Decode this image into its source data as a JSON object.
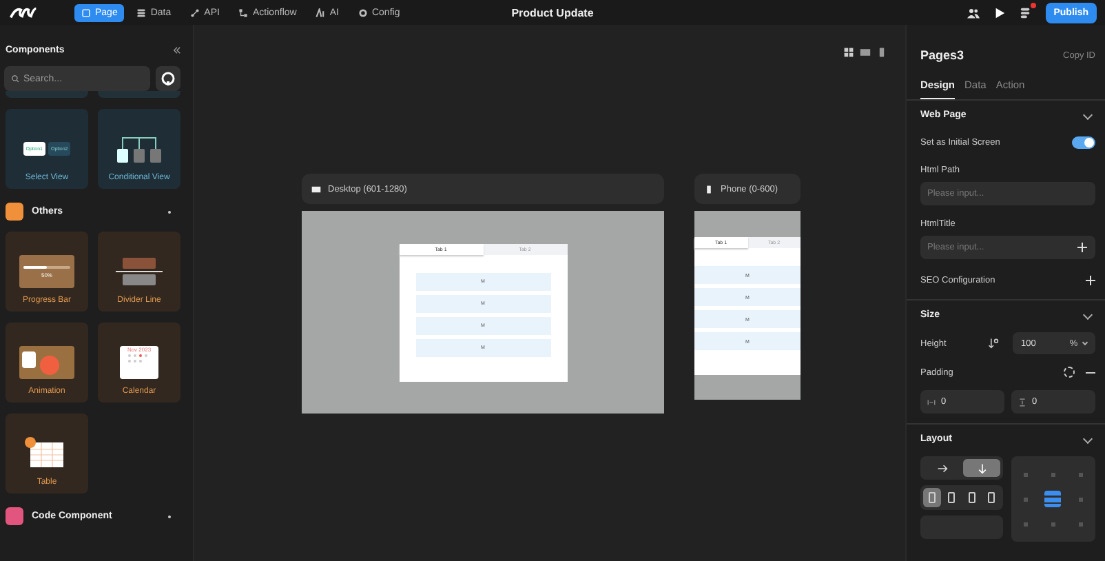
{
  "app_bar": {
    "nav": [
      {
        "label": "Page",
        "kind": "page",
        "selected": true
      },
      {
        "label": "Data",
        "kind": "data",
        "selected": false
      },
      {
        "label": "API",
        "kind": "api",
        "selected": false
      },
      {
        "label": "Actionflow",
        "kind": "flow",
        "selected": false
      },
      {
        "label": "AI",
        "kind": "ai",
        "selected": false
      },
      {
        "label": "Config",
        "kind": "config",
        "selected": false
      }
    ],
    "title": "Product Update",
    "notification": true,
    "publish": "Publish"
  },
  "components_panel": {
    "title": "Components",
    "search": {
      "placeholder": "Search..."
    },
    "top_cards": [
      {
        "kind": "select",
        "label": "Select View",
        "options": [
          "Option1",
          "Option2"
        ]
      },
      {
        "kind": "conditional",
        "label": "Conditional View"
      }
    ],
    "categories": [
      {
        "title": "Others",
        "kind": "others",
        "cards": [
          {
            "kind": "progress",
            "label": "Progress Bar",
            "level": 0.5,
            "reading": "50%"
          },
          {
            "kind": "divider",
            "label": "Divider Line"
          },
          {
            "kind": "animation",
            "label": "Animation"
          },
          {
            "kind": "calendar",
            "label": "Calendar",
            "month": "Nov 2023"
          },
          {
            "kind": "table",
            "label": "Table"
          }
        ]
      },
      {
        "title": "Code Component",
        "kind": "code"
      }
    ]
  },
  "canvas": {
    "views": [
      {
        "kind": "desktop",
        "label": "Desktop (601-1280)",
        "tabs": [
          {
            "label": "Tab 1",
            "selected": true
          },
          {
            "label": "Tab 2",
            "selected": false
          }
        ],
        "rows": [
          "M",
          "M",
          "M",
          "M"
        ]
      },
      {
        "kind": "phone",
        "label": "Phone (0-600)",
        "tabs": [
          {
            "label": "Tab 1",
            "selected": true
          },
          {
            "label": "Tab 2",
            "selected": false
          }
        ],
        "rows": [
          "M",
          "M",
          "M",
          "M"
        ]
      }
    ]
  },
  "inspector": {
    "title": "Pages3",
    "copy_id": "Copy ID",
    "tabs": [
      {
        "label": "Design",
        "selected": true
      },
      {
        "label": "Data",
        "selected": false
      },
      {
        "label": "Action",
        "selected": false
      }
    ],
    "web_page": {
      "title": "Web Page",
      "initial_screen": {
        "label": "Set as Initial Screen",
        "on": true
      },
      "html_path": {
        "label": "Html Path",
        "placeholder": "Please input..."
      },
      "html_title": {
        "label": "HtmlTitle",
        "placeholder": "Please input..."
      },
      "seo": "SEO Configuration"
    },
    "size": {
      "title": "Size",
      "height": {
        "label": "Height",
        "value": "100",
        "unit": "%"
      },
      "padding": {
        "label": "Padding",
        "horizontal": "0",
        "vertical": "0"
      }
    },
    "layout": {
      "title": "Layout",
      "direction": [
        {
          "kind": "row",
          "selected": false
        },
        {
          "kind": "column",
          "selected": true
        }
      ],
      "distribution": [
        {
          "selected": true
        },
        {
          "selected": false
        },
        {
          "selected": false
        },
        {
          "selected": false
        }
      ],
      "alignment": [
        {
          "selected": false
        },
        {
          "selected": false
        },
        {
          "selected": false
        },
        {
          "selected": false
        },
        {
          "selected": true
        },
        {
          "selected": false
        },
        {
          "selected": false
        },
        {
          "selected": false
        },
        {
          "selected": false
        }
      ]
    }
  }
}
